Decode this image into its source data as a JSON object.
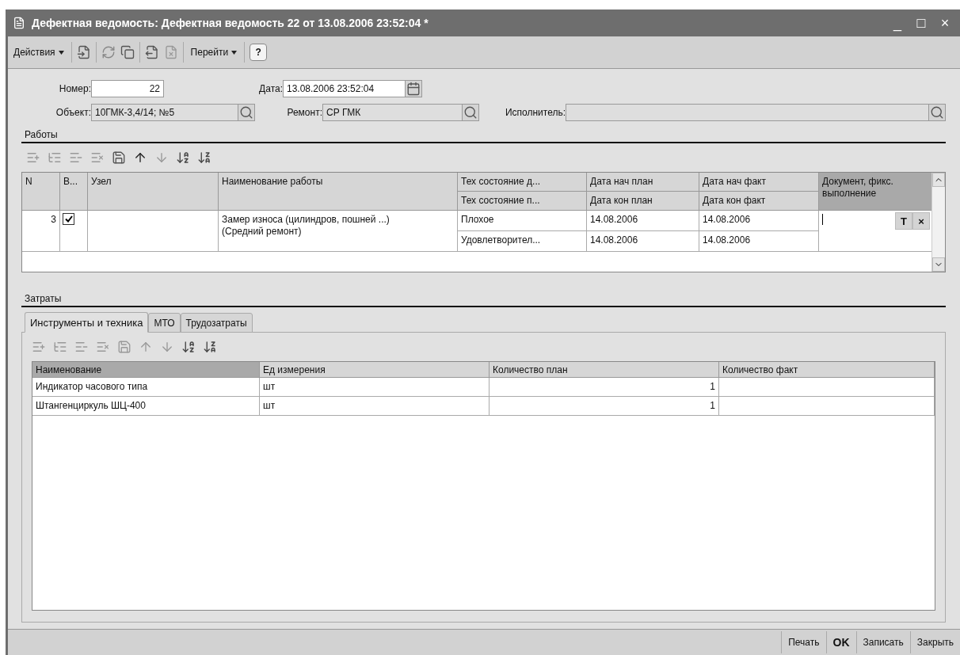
{
  "window": {
    "title": "Дефектная ведомость: Дефектная ведомость 22 от 13.08.2006 23:52:04 *",
    "controls": [
      "_",
      "□",
      "×"
    ]
  },
  "toolbar": {
    "actions_menu": "Действия",
    "goto_menu": "Перейти",
    "help": "?"
  },
  "header": {
    "number": {
      "label": "Номер:",
      "value": "22"
    },
    "date": {
      "label": "Дата:",
      "value": "13.08.2006 23:52:04"
    },
    "object": {
      "label": "Объект:",
      "value": "10ГМК-3,4/14; №5"
    },
    "repair": {
      "label": "Ремонт:",
      "value": "СР ГМК"
    },
    "executor": {
      "label": "Исполнитель:"
    }
  },
  "works": {
    "title": "Работы",
    "columns": [
      {
        "top": "N",
        "selected": false
      },
      {
        "top": "В...",
        "selected": false
      },
      {
        "top": "Узел",
        "selected": false
      },
      {
        "top": "Наименование работы",
        "selected": false
      },
      {
        "top": "Тех состояние д...",
        "bottom": "Тех состояние п...",
        "selected": false
      },
      {
        "top": "Дата нач план",
        "bottom": "Дата кон план",
        "selected": false
      },
      {
        "top": "Дата нач факт",
        "bottom": "Дата кон факт",
        "selected": false
      },
      {
        "top": "Документ, фикс. выполнение",
        "selected": true
      }
    ],
    "rows": [
      {
        "n": "3",
        "checked": true,
        "name": "Замер износа (цилиндров, пошней ...) (Средний ремонт)",
        "state_before": "Плохое",
        "state_after": "Удовлетворител...",
        "plan_start": "14.08.2006",
        "plan_end": "14.08.2006",
        "fact_start": "14.08.2006",
        "fact_end": "14.08.2006",
        "document": {
          "editing": true,
          "buttons": [
            "T",
            "×"
          ]
        }
      }
    ]
  },
  "costs": {
    "title": "Затраты",
    "tabs": [
      {
        "label": "Инструменты и техника",
        "selected": true
      },
      {
        "label": "МТО",
        "selected": false
      },
      {
        "label": "Трудозатраты",
        "selected": false
      }
    ],
    "columns": [
      {
        "label": "Наименование",
        "selected": true
      },
      {
        "label": "Ед измерения",
        "selected": false
      },
      {
        "label": "Количество план",
        "selected": false
      },
      {
        "label": "Количество факт",
        "selected": false
      }
    ],
    "rows": [
      [
        "Индикатор часового типа",
        "шт",
        "1"
      ],
      [
        "Штангенциркуль ШЦ-400",
        "шт",
        "1"
      ]
    ]
  },
  "buttons": [
    {
      "label": "Печать",
      "default": false
    },
    {
      "label": "OK",
      "default": true
    },
    {
      "label": "Записать",
      "default": false
    },
    {
      "label": "Закрыть",
      "default": false
    }
  ]
}
